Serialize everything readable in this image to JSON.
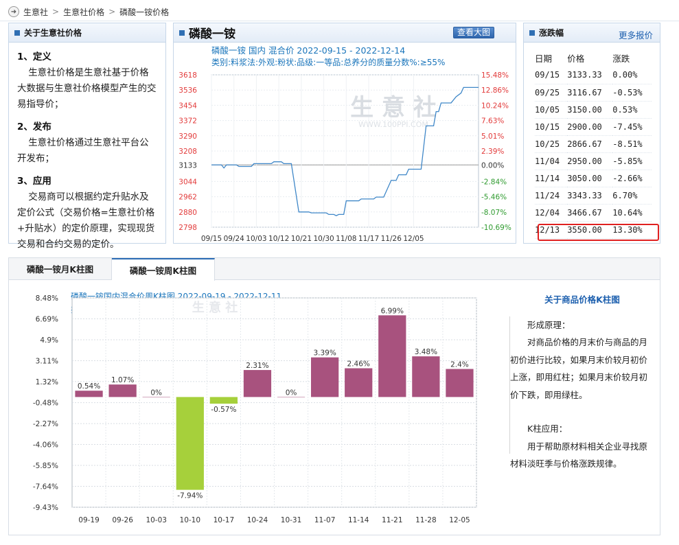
{
  "breadcrumb": {
    "items": [
      "生意社",
      "生意社价格",
      "磷酸一铵价格"
    ]
  },
  "about": {
    "title": "关于生意社价格",
    "sections": [
      {
        "heading": "1、定义",
        "text": "生意社价格是生意社基于价格大数据与生意社价格模型产生的交易指导价；"
      },
      {
        "heading": "2、发布",
        "text": "生意社价格通过生意社平台公开发布；"
      },
      {
        "heading": "3、应用",
        "text": "交易商可以根据约定升贴水及定价公式（交易价格=生意社价格+升贴水）的定价原理，实现现货交易和合约交易的定价。"
      }
    ]
  },
  "mid": {
    "title": "磷酸一铵",
    "big_chart_button": "查看大图",
    "watermark": "生 意 社",
    "watermark_url": "WWW.100PPI.COM"
  },
  "change_panel": {
    "title": "涨跌幅",
    "more": "更多报价",
    "headers": [
      "日期",
      "价格",
      "涨跌"
    ],
    "rows": [
      {
        "date": "09/15",
        "price": "3133.33",
        "change": "0.00%",
        "dir": "flat"
      },
      {
        "date": "09/25",
        "price": "3116.67",
        "change": "-0.53%",
        "dir": "down"
      },
      {
        "date": "10/05",
        "price": "3150.00",
        "change": "0.53%",
        "dir": "up"
      },
      {
        "date": "10/15",
        "price": "2900.00",
        "change": "-7.45%",
        "dir": "down"
      },
      {
        "date": "10/25",
        "price": "2866.67",
        "change": "-8.51%",
        "dir": "down"
      },
      {
        "date": "11/04",
        "price": "2950.00",
        "change": "-5.85%",
        "dir": "down"
      },
      {
        "date": "11/14",
        "price": "3050.00",
        "change": "-2.66%",
        "dir": "down"
      },
      {
        "date": "11/24",
        "price": "3343.33",
        "change": "6.70%",
        "dir": "up"
      },
      {
        "date": "12/04",
        "price": "3466.67",
        "change": "10.64%",
        "dir": "up"
      },
      {
        "date": "12/13",
        "price": "3550.00",
        "change": "13.30%",
        "dir": "up"
      }
    ]
  },
  "tabs": [
    "磷酸一铵月K柱图",
    "磷酸一铵周K柱图"
  ],
  "side_note": {
    "title": "关于商品价格K柱图",
    "p1": "形成原理：",
    "p2": "对商品价格的月末价与商品的月初价进行比较，如果月末价较月初价上涨，即用红柱；如果月末价较月初价下跌，即用绿柱。",
    "p3": "K柱应用：",
    "p4": "用于帮助原材料相关企业寻找原材料淡旺季与价格涨跌规律。"
  },
  "colors": {
    "line": "#3f87c8",
    "bar_up": "#a8527e",
    "bar_down": "#a6d03b",
    "left_axis": "#e23a3a",
    "right_axis_up": "#e23a3a",
    "right_axis_down": "#2e9a2e"
  },
  "chart_data": [
    {
      "type": "line",
      "title": "磷酸一铵 国内 混合价 2022-09-15 - 2022-12-14",
      "subtitle": "类别:料浆法:外观:粉状:品级:一等品:总养分的质量分数%:≥55%",
      "x_ticks": [
        "09/15",
        "09/24",
        "10/03",
        "10/12",
        "10/21",
        "10/30",
        "11/08",
        "11/17",
        "11/26",
        "12/05"
      ],
      "y_ticks_left": [
        "3618",
        "3536",
        "3454",
        "3372",
        "3290",
        "3208",
        "3133",
        "3044",
        "2962",
        "2880",
        "2798"
      ],
      "y_ticks_right": [
        "15.48%",
        "12.86%",
        "10.24%",
        "7.63%",
        "5.01%",
        "2.39%",
        "0.00%",
        "-2.84%",
        "-5.46%",
        "-8.07%",
        "-10.69%"
      ],
      "ylim": [
        2798,
        3618
      ],
      "base": 3133.33,
      "series": [
        {
          "points": [
            [
              0,
              3133.33
            ],
            [
              4,
              3133.33
            ],
            [
              5,
              3116.67
            ],
            [
              6,
              3133.33
            ],
            [
              10,
              3133.33
            ],
            [
              11,
              3125
            ],
            [
              16,
              3125
            ],
            [
              17,
              3140
            ],
            [
              24,
              3140
            ],
            [
              25,
              3150
            ],
            [
              28,
              3150
            ],
            [
              29,
              3140
            ],
            [
              32,
              3140
            ],
            [
              35,
              2880
            ],
            [
              39,
              2880
            ],
            [
              40,
              2875
            ],
            [
              46,
              2875
            ],
            [
              47,
              2866.67
            ],
            [
              49,
              2866.67
            ],
            [
              50,
              2860
            ],
            [
              51,
              2866.67
            ],
            [
              53,
              2866.67
            ],
            [
              54,
              2940
            ],
            [
              59,
              2940
            ],
            [
              60,
              2950
            ],
            [
              65,
              2950
            ],
            [
              66,
              2960
            ],
            [
              69,
              2960
            ],
            [
              72,
              3050
            ],
            [
              74,
              3050
            ],
            [
              75,
              3080
            ],
            [
              78,
              3080
            ],
            [
              79,
              3110
            ],
            [
              84,
              3110
            ],
            [
              86,
              3343.33
            ],
            [
              89,
              3343.33
            ],
            [
              90,
              3420
            ],
            [
              91,
              3420
            ],
            [
              92,
              3466.67
            ],
            [
              96,
              3466.67
            ],
            [
              98,
              3500
            ],
            [
              100,
              3520
            ],
            [
              101,
              3550
            ],
            [
              107,
              3550
            ]
          ]
        }
      ],
      "x_max": 107
    },
    {
      "type": "bar",
      "title": "磷酸一铵国内混合价周K柱图 2022-09-19 - 2022-12-11",
      "subtitle": "类别:料浆法:外观:粉状:品级:一等品:总养分的质量分数%:≥55%",
      "categories": [
        "09-19",
        "09-26",
        "10-03",
        "10-10",
        "10-17",
        "10-24",
        "10-31",
        "11-07",
        "11-14",
        "11-21",
        "11-28",
        "12-05"
      ],
      "values": [
        0.54,
        1.07,
        0,
        -7.94,
        -0.57,
        2.31,
        0,
        3.39,
        2.46,
        6.99,
        3.48,
        2.4
      ],
      "value_labels": [
        "0.54%",
        "1.07%",
        "0%",
        "-7.94%",
        "-0.57%",
        "2.31%",
        "0%",
        "3.39%",
        "2.46%",
        "6.99%",
        "3.48%",
        "2.4%"
      ],
      "y_ticks": [
        "8.48%",
        "6.69%",
        "4.9%",
        "3.11%",
        "1.32%",
        "-0.48%",
        "-2.27%",
        "-4.06%",
        "-5.85%",
        "-7.64%",
        "-9.43%"
      ],
      "ylim": [
        -9.43,
        8.48
      ],
      "watermark": "生 意 社"
    }
  ]
}
